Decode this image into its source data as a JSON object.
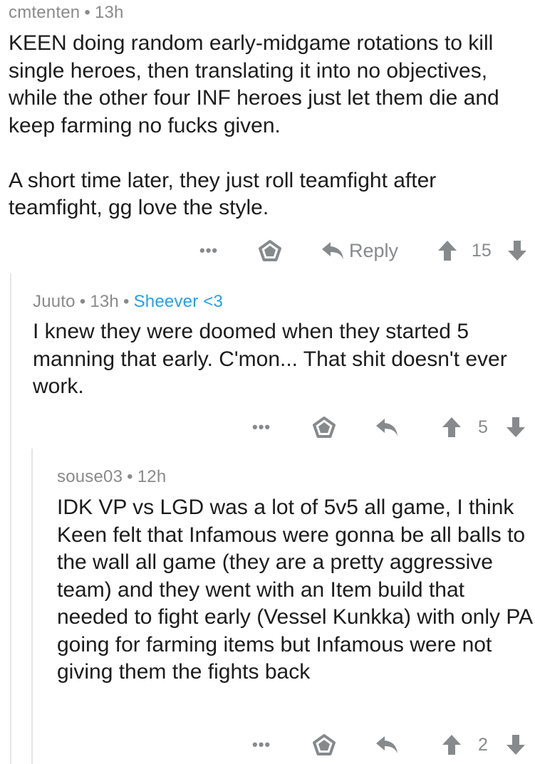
{
  "comments": [
    {
      "username": "cmtenten",
      "time": "13h",
      "flair": "",
      "body": [
        "KEEN doing random early-midgame rotations to kill single heroes, then translating it into no objectives, while the other four INF heroes just let them die and keep farming no fucks given.",
        "A short time later, they just roll teamfight after teamfight, gg love the style."
      ],
      "actions": {
        "more": "•••",
        "reply_label": "Reply",
        "score": "15"
      }
    },
    {
      "username": "Juuto",
      "time": "13h",
      "flair": "Sheever <3",
      "body": [
        "I knew they were doomed when they started 5 manning that early. C'mon... That shit doesn't ever work."
      ],
      "actions": {
        "more": "•••",
        "reply_label": "",
        "score": "5"
      }
    },
    {
      "username": "souse03",
      "time": "12h",
      "flair": "",
      "body": [
        "IDK VP vs LGD was a lot of 5v5 all game, I think Keen felt that Infamous were gonna be all balls to the wall all game (they are a pretty aggressive team) and they went with an Item build that needed to fight early (Vessel Kunkka) with only PA going for farming items but Infamous were not giving them the fights back"
      ],
      "actions": {
        "more": "•••",
        "reply_label": "",
        "score": "2"
      }
    }
  ],
  "separator": "•",
  "icons": {
    "more": "more-dots-icon",
    "save": "pentagon-save-icon",
    "reply": "reply-arrow-icon",
    "upvote": "upvote-arrow-icon",
    "downvote": "downvote-arrow-icon"
  },
  "colors": {
    "meta": "#8a8a8a",
    "flair": "#24a0ed",
    "body": "#1c1c1c",
    "icon": "#878a8c",
    "thread_line": "#e5e5e5"
  }
}
